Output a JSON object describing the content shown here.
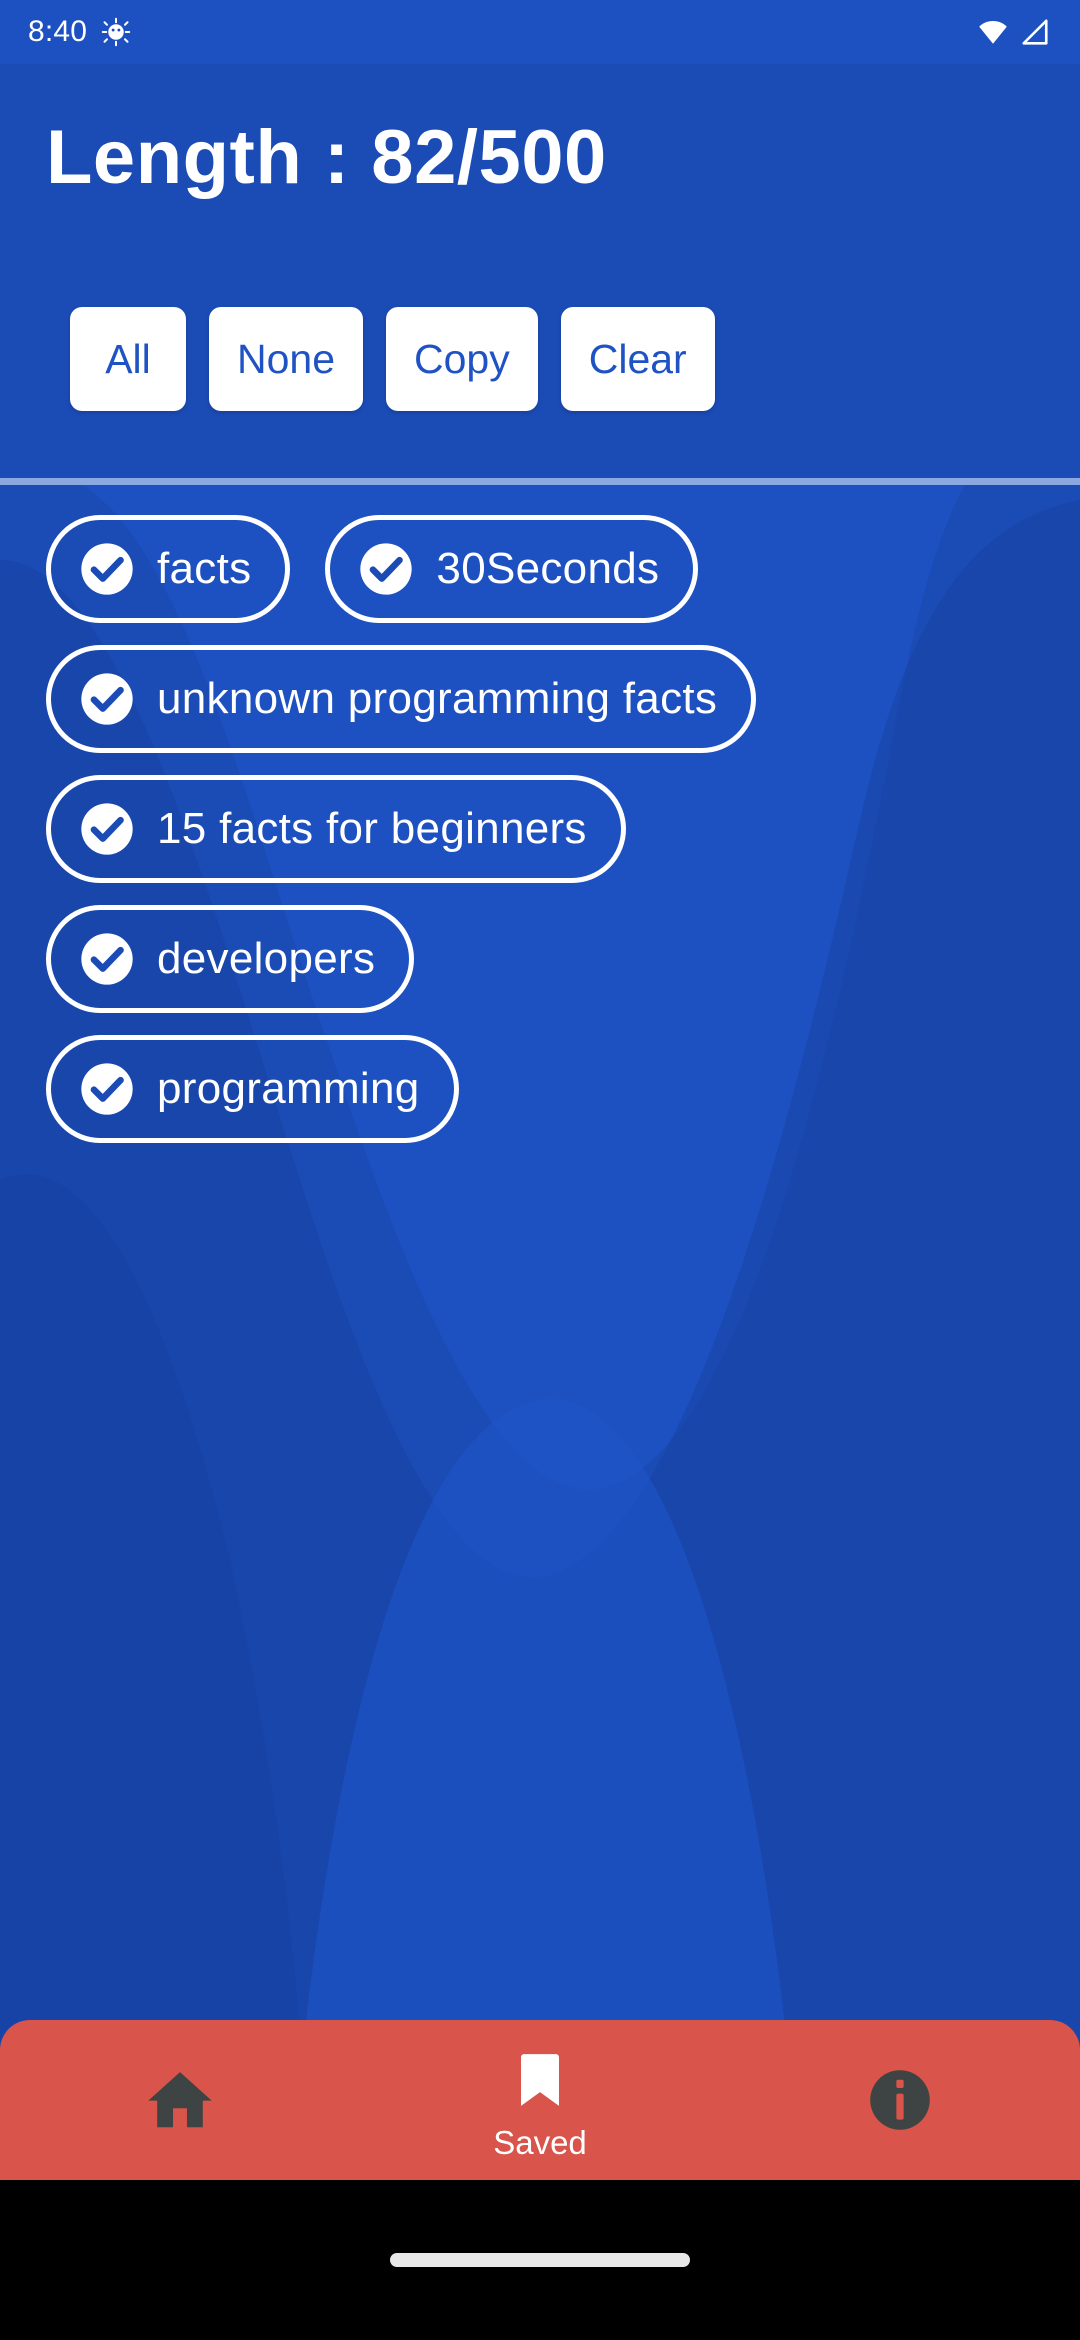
{
  "status_bar": {
    "time": "8:40",
    "icons": [
      "android-debug-icon",
      "wifi-icon",
      "cell-signal-icon"
    ]
  },
  "header": {
    "title": "Length : 82/500",
    "current_length": 82,
    "max_length": 500,
    "buttons": [
      {
        "label": "All",
        "name": "select-all-button"
      },
      {
        "label": "None",
        "name": "select-none-button"
      },
      {
        "label": "Copy",
        "name": "copy-button"
      },
      {
        "label": "Clear",
        "name": "clear-button"
      }
    ]
  },
  "chips": [
    {
      "label": "facts",
      "checked": true
    },
    {
      "label": "30Seconds",
      "checked": true
    },
    {
      "label": "unknown programming facts",
      "checked": true
    },
    {
      "label": "15 facts for beginners",
      "checked": true
    },
    {
      "label": "developers",
      "checked": true
    },
    {
      "label": "programming",
      "checked": true
    }
  ],
  "bottom_nav": {
    "items": [
      {
        "label": "",
        "icon": "home-icon",
        "active": false
      },
      {
        "label": "Saved",
        "icon": "bookmark-icon",
        "active": true
      },
      {
        "label": "",
        "icon": "info-icon",
        "active": false
      }
    ]
  },
  "colors": {
    "background_blue": "#1b4bb5",
    "wave_blue_light": "#1f55c9",
    "wave_blue_dark": "#16409e",
    "accent_white": "#ffffff",
    "button_text_blue": "#1f53c4",
    "nav_red": "#d9544a",
    "nav_icon_inactive": "#3e4343",
    "divider_blue": "#8ba9e0"
  }
}
